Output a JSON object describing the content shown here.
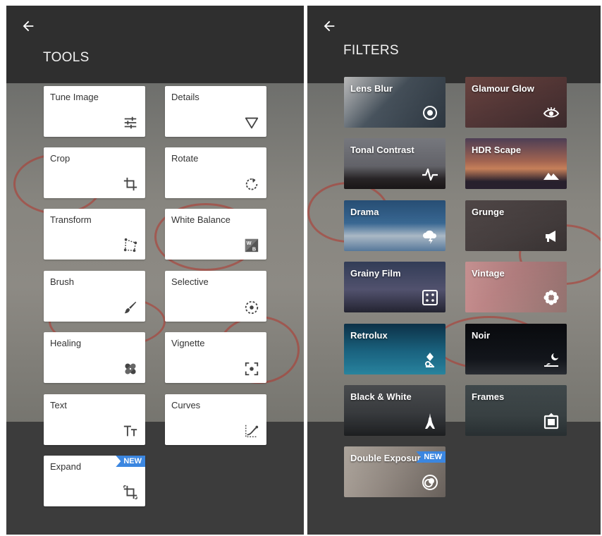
{
  "tools_screen": {
    "back_icon": "arrow-left-icon",
    "title": "TOOLS",
    "tiles": [
      {
        "label": "Tune Image",
        "icon": "sliders-icon"
      },
      {
        "label": "Details",
        "icon": "triangle-down-icon"
      },
      {
        "label": "Crop",
        "icon": "crop-icon"
      },
      {
        "label": "Rotate",
        "icon": "rotate-icon"
      },
      {
        "label": "Transform",
        "icon": "transform-icon"
      },
      {
        "label": "White Balance",
        "icon": "white-balance-icon"
      },
      {
        "label": "Brush",
        "icon": "brush-icon"
      },
      {
        "label": "Selective",
        "icon": "selective-icon"
      },
      {
        "label": "Healing",
        "icon": "bandage-icon"
      },
      {
        "label": "Vignette",
        "icon": "vignette-icon"
      },
      {
        "label": "Text",
        "icon": "text-icon"
      },
      {
        "label": "Curves",
        "icon": "curves-icon"
      },
      {
        "label": "Expand",
        "icon": "expand-icon",
        "badge": "NEW"
      }
    ],
    "wb_glyph": "W B"
  },
  "filters_screen": {
    "back_icon": "arrow-left-icon",
    "title": "FILTERS",
    "tiles": [
      {
        "label": "Lens Blur",
        "icon": "lens-blur-icon"
      },
      {
        "label": "Glamour Glow",
        "icon": "eye-icon"
      },
      {
        "label": "Tonal Contrast",
        "icon": "pulse-icon"
      },
      {
        "label": "HDR Scape",
        "icon": "mountain-icon"
      },
      {
        "label": "Drama",
        "icon": "cloud-lightning-icon"
      },
      {
        "label": "Grunge",
        "icon": "megaphone-icon"
      },
      {
        "label": "Grainy Film",
        "icon": "dice-icon"
      },
      {
        "label": "Vintage",
        "icon": "flower-icon"
      },
      {
        "label": "Retrolux",
        "icon": "retrolux-icon"
      },
      {
        "label": "Noir",
        "icon": "moon-landscape-icon"
      },
      {
        "label": "Black & White",
        "icon": "eiffel-tower-icon"
      },
      {
        "label": "Frames",
        "icon": "frame-icon"
      },
      {
        "label": "Double Exposure",
        "icon": "double-exposure-icon",
        "badge": "NEW"
      }
    ]
  },
  "colors": {
    "badge": "#3b86e0",
    "panel": "#3b3b3b",
    "header": "#2f2f2f"
  }
}
